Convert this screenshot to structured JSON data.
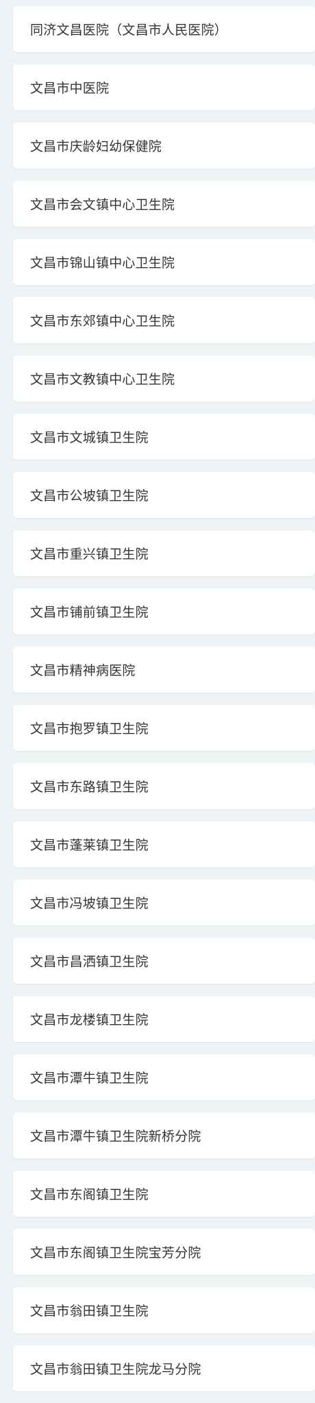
{
  "hospitals": [
    {
      "name": "同济文昌医院（文昌市人民医院）"
    },
    {
      "name": "文昌市中医院"
    },
    {
      "name": "文昌市庆龄妇幼保健院"
    },
    {
      "name": "文昌市会文镇中心卫生院"
    },
    {
      "name": "文昌市锦山镇中心卫生院"
    },
    {
      "name": "文昌市东郊镇中心卫生院"
    },
    {
      "name": "文昌市文教镇中心卫生院"
    },
    {
      "name": "文昌市文城镇卫生院"
    },
    {
      "name": "文昌市公坡镇卫生院"
    },
    {
      "name": "文昌市重兴镇卫生院"
    },
    {
      "name": "文昌市铺前镇卫生院"
    },
    {
      "name": "文昌市精神病医院"
    },
    {
      "name": "文昌市抱罗镇卫生院"
    },
    {
      "name": "文昌市东路镇卫生院"
    },
    {
      "name": "文昌市蓬莱镇卫生院"
    },
    {
      "name": "文昌市冯坡镇卫生院"
    },
    {
      "name": "文昌市昌洒镇卫生院"
    },
    {
      "name": "文昌市龙楼镇卫生院"
    },
    {
      "name": "文昌市潭牛镇卫生院"
    },
    {
      "name": "文昌市潭牛镇卫生院新桥分院"
    },
    {
      "name": "文昌市东阁镇卫生院"
    },
    {
      "name": "文昌市东阁镇卫生院宝芳分院"
    },
    {
      "name": "文昌市翁田镇卫生院"
    },
    {
      "name": "文昌市翁田镇卫生院龙马分院"
    }
  ]
}
